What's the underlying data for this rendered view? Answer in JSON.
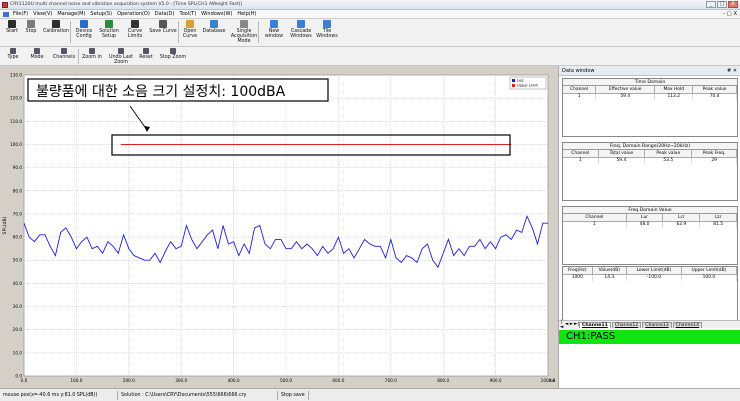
{
  "window": {
    "title": "CRY2120U multi channel noise and vibration acquisition system V5.0 - [Time SPL(CH1 AWeight Fast)]",
    "buttons": [
      "_",
      "□",
      "X"
    ]
  },
  "menu": {
    "items": [
      "File(F)",
      "View(V)",
      "Manage(M)",
      "Setup(S)",
      "Operation(O)",
      "Data(D)",
      "Tool(T)",
      "Windows(W)",
      "Help(H)"
    ],
    "right_controls": [
      "-",
      "□",
      "X"
    ]
  },
  "toolbar1": [
    {
      "label": "Start",
      "icon": "start-icon",
      "color": "#2c2c2c"
    },
    {
      "label": "Stop",
      "icon": "stop-icon",
      "color": "#7a7a7a"
    },
    {
      "label": "Calibration",
      "icon": "calibration-icon",
      "color": "#2c2c2c"
    },
    {
      "label": "Device Config",
      "icon": "device-config-icon",
      "color": "#2a6dc6"
    },
    {
      "label": "Solution Setup",
      "icon": "solution-setup-icon",
      "color": "#2a8c3a"
    },
    {
      "label": "Curve Limits",
      "icon": "curve-limits-icon",
      "color": "#333333"
    },
    {
      "label": "Save Curve",
      "icon": "save-curve-icon",
      "color": "#555555"
    },
    {
      "label": "Open Curve",
      "icon": "open-curve-icon",
      "color": "#d9a130"
    },
    {
      "label": "Database",
      "icon": "database-icon",
      "color": "#3a7fd0"
    },
    {
      "label": "Single Acquisition Mode",
      "icon": "acquisition-mode-icon",
      "color": "#888888"
    },
    {
      "label": "New window",
      "icon": "new-window-icon",
      "color": "#3a7fd0"
    },
    {
      "label": "Cascade Windows",
      "icon": "cascade-windows-icon",
      "color": "#3a7fd0"
    },
    {
      "label": "Tile Windows",
      "icon": "tile-windows-icon",
      "color": "#3a7fd0"
    }
  ],
  "toolbar2": [
    {
      "label": "Type",
      "icon": "type-icon"
    },
    {
      "label": "Mode",
      "icon": "mode-icon"
    },
    {
      "label": "Channels",
      "icon": "channels-icon"
    },
    {
      "label": "Zoom in",
      "icon": "zoom-in-icon"
    },
    {
      "label": "Undo Last Zoom",
      "icon": "undo-zoom-icon"
    },
    {
      "label": "Reset",
      "icon": "reset-icon"
    },
    {
      "label": "Stop Zoom",
      "icon": "stop-zoom-icon"
    }
  ],
  "annotation": {
    "text": "불량품에 대한 소음 크기 설정치: 100dBA"
  },
  "chart_data": {
    "type": "line",
    "ylabel": "SPL(dB)",
    "xunit": "ms",
    "xlim": [
      0,
      1000
    ],
    "ylim": [
      0,
      130
    ],
    "xticks": [
      "0.0",
      "100.0",
      "200.0",
      "300.0",
      "400.0",
      "500.0",
      "600.0",
      "700.0",
      "800.0",
      "900.0",
      "1000.0"
    ],
    "yticks": [
      "0.0",
      "10.0",
      "20.0",
      "30.0",
      "40.0",
      "50.0",
      "60.0",
      "70.0",
      "80.0",
      "90.0",
      "100.0",
      "110.0",
      "120.0",
      "130.0"
    ],
    "grid": true,
    "legend_position": "top-right",
    "series": [
      {
        "name": "Leq",
        "color": "#2020d0",
        "x": [
          0,
          10,
          20,
          30,
          40,
          50,
          60,
          70,
          80,
          90,
          100,
          110,
          120,
          130,
          140,
          150,
          160,
          170,
          180,
          190,
          200,
          210,
          220,
          230,
          240,
          250,
          260,
          270,
          280,
          290,
          300,
          310,
          320,
          330,
          340,
          350,
          360,
          370,
          380,
          390,
          400,
          410,
          420,
          430,
          440,
          450,
          460,
          470,
          480,
          490,
          500,
          510,
          520,
          530,
          540,
          550,
          560,
          570,
          580,
          590,
          600,
          610,
          620,
          630,
          640,
          650,
          660,
          670,
          680,
          690,
          700,
          710,
          720,
          730,
          740,
          750,
          760,
          770,
          780,
          790,
          800,
          810,
          820,
          830,
          840,
          850,
          860,
          870,
          880,
          890,
          900,
          910,
          920,
          930,
          940,
          950,
          960,
          970,
          980,
          990,
          1000
        ],
        "values": [
          66,
          60,
          58,
          61,
          61,
          56,
          52,
          62,
          64,
          60,
          55,
          58,
          60,
          55,
          56,
          53,
          58,
          56,
          53,
          61,
          55,
          52,
          51,
          50,
          50,
          53,
          49,
          54,
          58,
          55,
          56,
          65,
          59,
          55,
          58,
          61,
          63,
          55,
          65,
          57,
          58,
          52,
          57,
          53,
          64,
          65,
          57,
          55,
          59,
          59,
          55,
          55,
          58,
          55,
          57,
          55,
          52,
          56,
          53,
          55,
          60,
          53,
          55,
          51,
          55,
          59,
          57,
          56,
          56,
          51,
          59,
          51,
          49,
          52,
          51,
          49,
          55,
          57,
          50,
          47,
          53,
          59,
          52,
          55,
          52,
          56,
          56,
          59,
          55,
          58,
          55,
          60,
          61,
          59,
          63,
          62,
          69,
          64,
          57,
          66,
          66
        ]
      },
      {
        "name": "Upper Limit",
        "color": "#e02020",
        "x": [
          185,
          930
        ],
        "values": [
          100,
          100
        ]
      }
    ]
  },
  "data_window": {
    "title": "Data window",
    "pin": "# ✕",
    "groups": [
      {
        "title": "Time Domain",
        "headers": [
          "Channel",
          "Effective value",
          "Max Hold",
          "Peak value"
        ],
        "rows": [
          [
            "1",
            "59.4",
            "113.2",
            "70.4"
          ]
        ]
      },
      {
        "title": "Freq. Domain Range(20Hz~20kHz)",
        "headers": [
          "Channel",
          "Total value",
          "Peak value",
          "Peak Freq."
        ],
        "rows": [
          [
            "1",
            "59.4",
            "53.5",
            "29"
          ]
        ]
      },
      {
        "title": "Freq.Domain Value",
        "headers": [
          "Channel",
          "Lur",
          "Lcr",
          "Lzr"
        ],
        "rows": [
          [
            "1",
            "48.0",
            "62.9",
            "81.5"
          ]
        ]
      },
      {
        "title": "",
        "headers": [
          "Freq(Hz)",
          "Value(dB)",
          "Lower Limit(dB)",
          "Upper Limit(dB)"
        ],
        "rows": [
          [
            "1000",
            "14.3",
            "-100.0",
            "100.0"
          ]
        ]
      }
    ],
    "tabs": [
      "Channe11",
      "Channe12",
      "Channe13",
      "Channe14"
    ],
    "tab_nav": [
      "|◄",
      "◄",
      "►",
      "►|"
    ],
    "pass_text": "CH1:PASS"
  },
  "status": {
    "mouse": "mouse pos(x=-40.6 ms y:81.0 SPL(dB))",
    "solution": "Solution : C:\\Users\\CRY\\Documents\\555\\666\\666.cry",
    "state": "Stop save"
  }
}
